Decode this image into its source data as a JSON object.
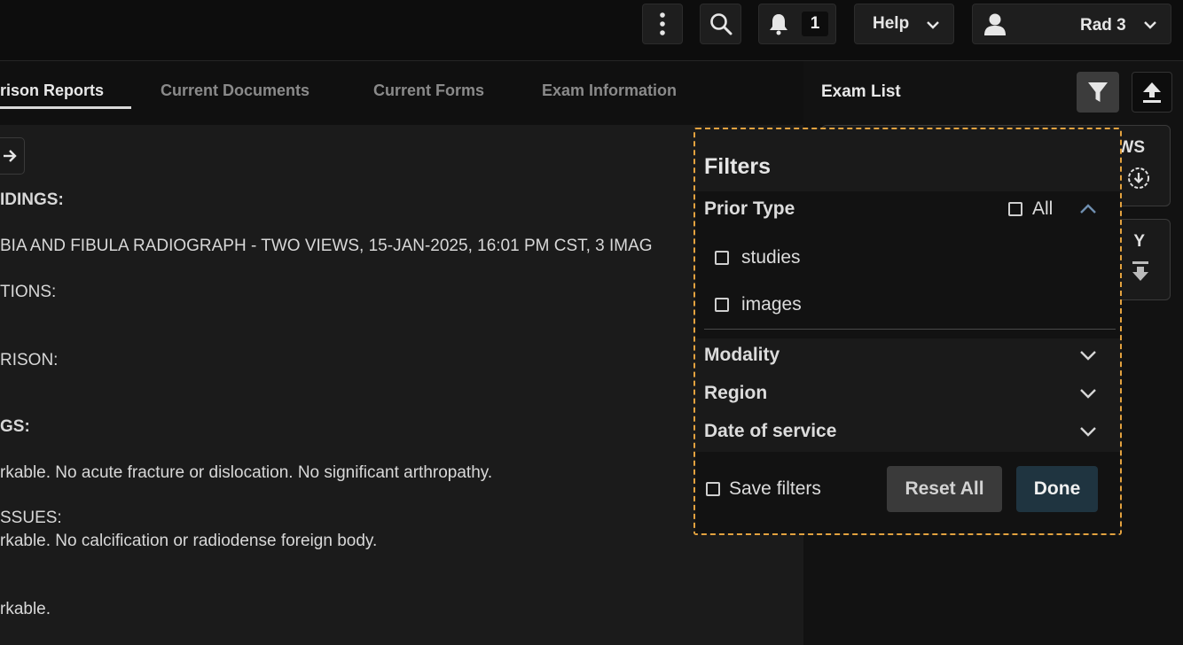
{
  "header": {
    "more_icon": "kebab-vertical-icon",
    "search_icon": "search-icon",
    "notifications": {
      "icon": "bell-icon",
      "count": "1"
    },
    "help_label": "Help",
    "user_name": "Rad 3"
  },
  "tabs": [
    {
      "label": "rison Reports",
      "active": true
    },
    {
      "label": "Current Documents",
      "active": false
    },
    {
      "label": "Current Forms",
      "active": false
    },
    {
      "label": "Exam Information",
      "active": false
    }
  ],
  "report": {
    "lines": [
      "IDINGS:",
      "BIA AND FIBULA RADIOGRAPH - TWO VIEWS, 15-JAN-2025, 16:01 PM CST, 3 IMAG",
      "TIONS:",
      "RISON:",
      "GS:",
      "rkable. No acute fracture or dislocation. No significant arthropathy.",
      "SSUES:",
      "rkable. No calcification or radiodense foreign body.",
      "rkable."
    ]
  },
  "exam_list": {
    "title": "Exam List",
    "card1_peek": "WS",
    "card2_peek": "Y"
  },
  "filters": {
    "title": "Filters",
    "prior_type": {
      "label": "Prior Type",
      "all_label": "All",
      "options": [
        "studies",
        "images"
      ]
    },
    "sections": [
      "Modality",
      "Region",
      "Date of service"
    ],
    "save_filters_label": "Save filters",
    "reset_label": "Reset All",
    "done_label": "Done"
  },
  "colors": {
    "highlight_border": "#e3a23f",
    "done_button": "#1f3440",
    "prior_chevron": "#6f8fb0"
  }
}
